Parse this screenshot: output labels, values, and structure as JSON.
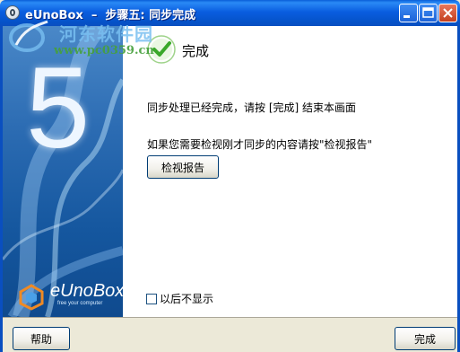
{
  "window": {
    "title": "eUnoBox  –  步骤五: 同步完成"
  },
  "watermark": {
    "site_name": "河东软件园",
    "url": "www.pc0359.cn"
  },
  "banner": {
    "step_number": "5",
    "brand_name": "eUnoBox",
    "brand_tagline": "free your computer"
  },
  "content": {
    "heading": "完成",
    "message_done": "同步处理已经完成，请按 [完成] 结束本画面",
    "message_review": "如果您需要检视刚才同步的内容请按\"检视报告\"",
    "review_button": "检视报告",
    "dont_show_label": "以后不显示",
    "dont_show_checked": false
  },
  "footer": {
    "help_button": "帮助",
    "finish_button": "完成"
  },
  "colors": {
    "titlebar": "#0a5ee0",
    "banner": "#2c6cb3",
    "check_green": "#3aa82a"
  }
}
